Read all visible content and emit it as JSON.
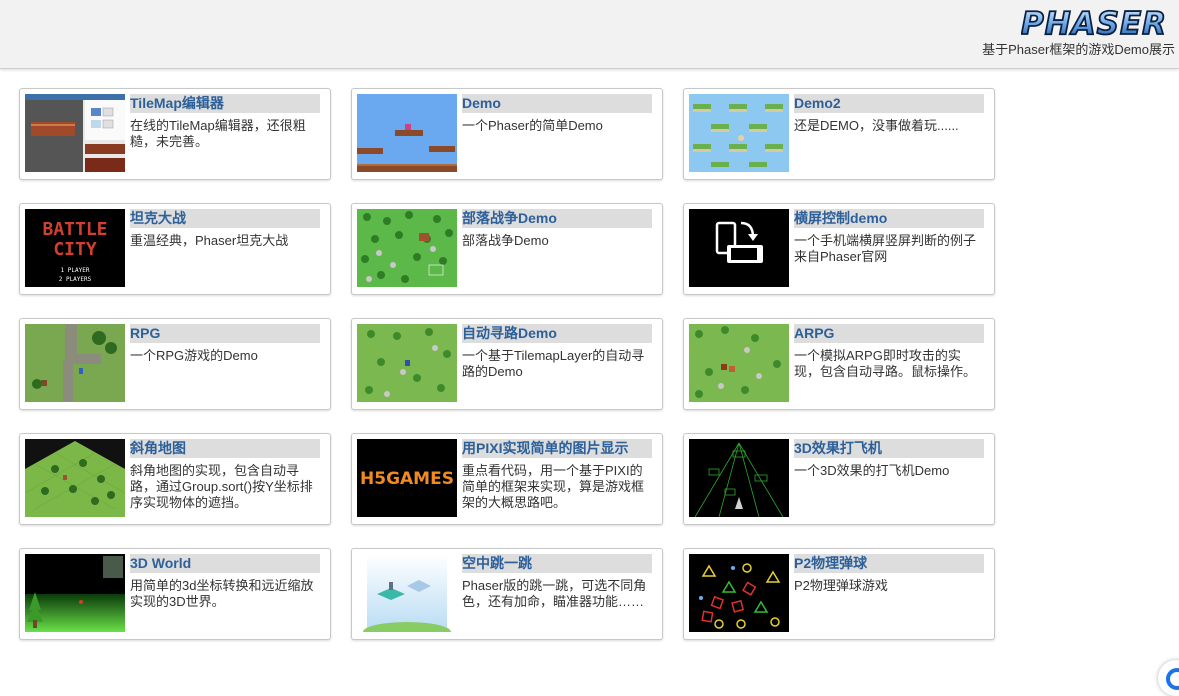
{
  "header": {
    "logo_text": "PHASER",
    "subtitle": "基于Phaser框架的游戏Demo展示"
  },
  "colors": {
    "title_text": "#2d6099",
    "title_bg": "#dddddd",
    "header_bg": "#f2f2f2"
  },
  "cards": [
    {
      "title": "TileMap编辑器",
      "desc": "在线的TileMap编辑器，还很粗糙，未完善。"
    },
    {
      "title": "Demo",
      "desc": "一个Phaser的简单Demo"
    },
    {
      "title": "Demo2",
      "desc": "还是DEMO，没事做着玩......"
    },
    {
      "title": "坦克大战",
      "desc": "重温经典，Phaser坦克大战",
      "thumb_text": [
        "BATTLE",
        "CITY",
        "1 PLAYER",
        "2 PLAYERS"
      ]
    },
    {
      "title": "部落战争Demo",
      "desc": "部落战争Demo"
    },
    {
      "title": "横屏控制demo",
      "desc": "一个手机端横屏竖屏判断的例子 来自Phaser官网"
    },
    {
      "title": "RPG",
      "desc": "一个RPG游戏的Demo"
    },
    {
      "title": "自动寻路Demo",
      "desc": "一个基于TilemapLayer的自动寻路的Demo"
    },
    {
      "title": "ARPG",
      "desc": "一个模拟ARPG即时攻击的实现，包含自动寻路。鼠标操作。"
    },
    {
      "title": "斜角地图",
      "desc": "斜角地图的实现，包含自动寻路，通过Group.sort()按Y坐标排序实现物体的遮挡。"
    },
    {
      "title": "用PIXI实现简单的图片显示",
      "desc": "重点看代码，用一个基于PIXI的简单的框架来实现，算是游戏框架的大概思路吧。",
      "thumb_text": [
        "H5GAMES"
      ]
    },
    {
      "title": "3D效果打飞机",
      "desc": "一个3D效果的打飞机Demo"
    },
    {
      "title": "3D World",
      "desc": "用简单的3d坐标转换和远近缩放实现的3D世界。"
    },
    {
      "title": "空中跳一跳",
      "desc": "Phaser版的跳一跳，可选不同角色，还有加命，瞄准器功能……"
    },
    {
      "title": "P2物理弹球",
      "desc": "P2物理弹球游戏"
    }
  ]
}
